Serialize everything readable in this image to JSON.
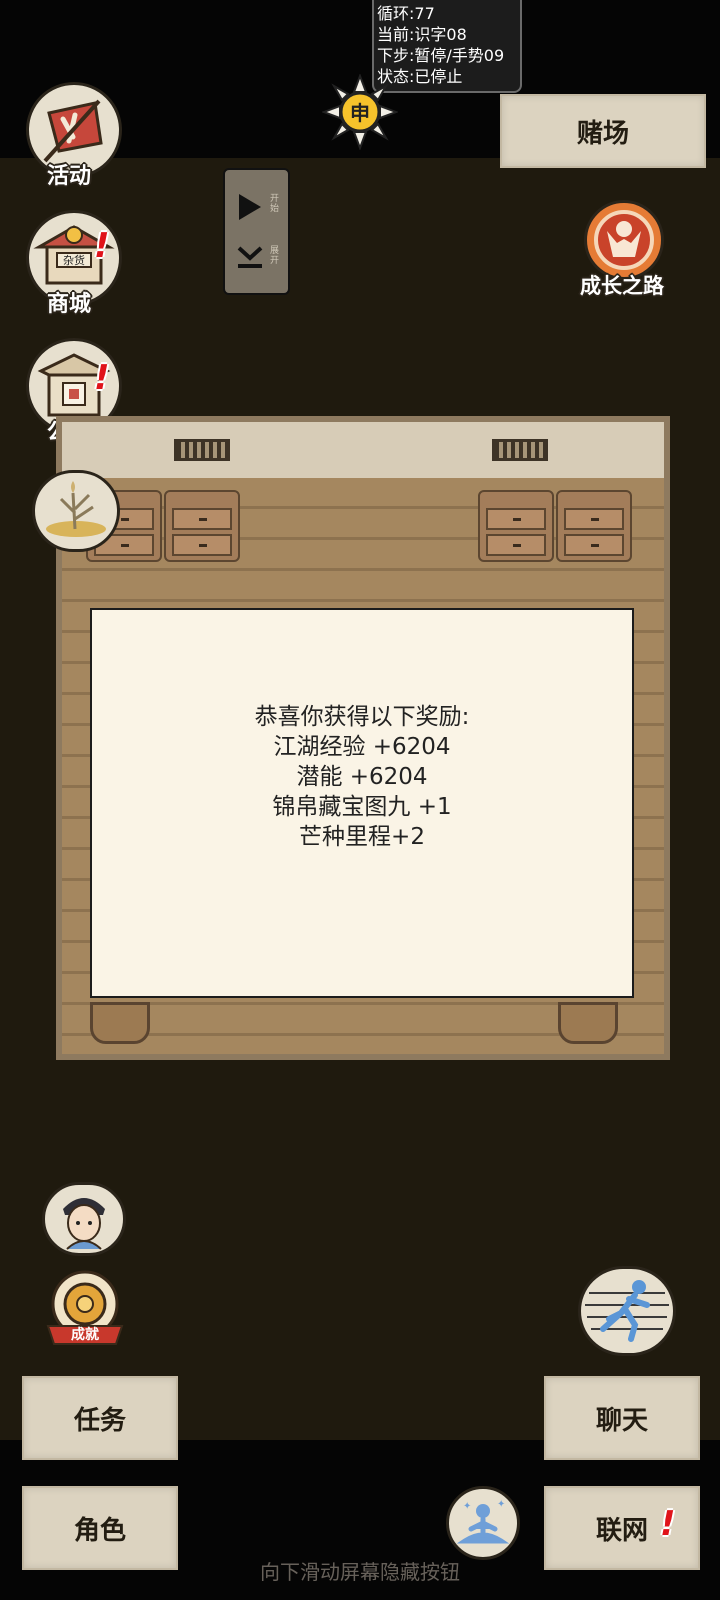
{
  "status": {
    "loop": "循环:77",
    "current": "当前:识字08",
    "next": "下步:暂停/手势09",
    "state": "状态:已停止"
  },
  "time_glyph": "申",
  "header": {
    "casino_label": "赌场"
  },
  "sidebar_left": [
    {
      "label": "活动",
      "icon": "banner-icon"
    },
    {
      "label": "商城",
      "icon": "shop-icon",
      "badge": "!",
      "sign": "杂货"
    },
    {
      "label": "公告",
      "icon": "notice-icon",
      "badge": "!"
    },
    {
      "label": "",
      "icon": "grain-icon"
    }
  ],
  "growth": {
    "label": "成长之路",
    "icon": "growth-icon"
  },
  "control_panel": {
    "start_caption": "开始",
    "expand_caption": "展开"
  },
  "reward_modal": {
    "lines": [
      "恭喜你获得以下奖励:",
      "江湖经验 +6204",
      "潜能 +6204",
      "锦帛藏宝图九 +1",
      "芒种里程+2"
    ]
  },
  "achievement": {
    "ribbon": "成就"
  },
  "bottom_buttons": {
    "task": "任务",
    "chat": "聊天",
    "role": "角色",
    "network": "联网",
    "network_badge": "!"
  },
  "hint": "向下滑动屏幕隐藏按钮",
  "colors": {
    "background": "#1f1a0e",
    "paper": "#faf4e6",
    "button_paper": "#dcd3c0",
    "badge_red": "#e0131a"
  }
}
